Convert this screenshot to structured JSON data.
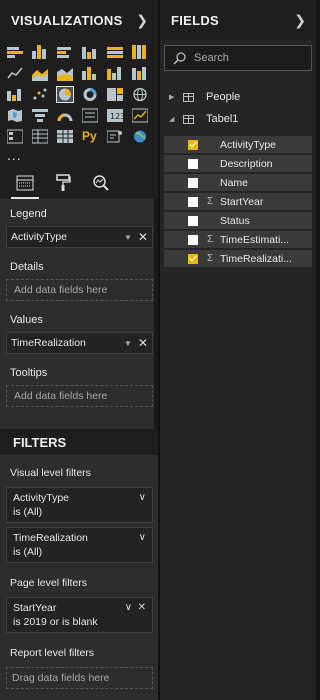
{
  "visualizations": {
    "title": "VISUALIZATIONS",
    "more": "..."
  },
  "tabs": [
    "fields-tab",
    "format-tab",
    "analytics-tab"
  ],
  "wells": {
    "legend_label": "Legend",
    "legend_field": "ActivityType",
    "details_label": "Details",
    "details_placeholder": "Add data fields here",
    "values_label": "Values",
    "values_field": "TimeRealization",
    "tooltips_label": "Tooltips",
    "tooltips_placeholder": "Add data fields here"
  },
  "filters": {
    "title": "FILTERS",
    "visual_level": "Visual level filters",
    "visual_items": [
      {
        "name": "ActivityType",
        "state": "is (All)"
      },
      {
        "name": "TimeRealization",
        "state": "is (All)"
      }
    ],
    "page_level": "Page level filters",
    "page_items": [
      {
        "name": "StartYear",
        "state": "is 2019 or is blank"
      }
    ],
    "report_level": "Report level filters",
    "report_placeholder": "Drag data fields here"
  },
  "fields": {
    "title": "FIELDS",
    "search_placeholder": "Search",
    "tables": [
      "People",
      "Tabel1"
    ],
    "items": [
      {
        "name": "ActivityType",
        "checked": true,
        "sigma": false
      },
      {
        "name": "Description",
        "checked": false,
        "sigma": false
      },
      {
        "name": "Name",
        "checked": false,
        "sigma": false
      },
      {
        "name": "StartYear",
        "checked": false,
        "sigma": true
      },
      {
        "name": "Status",
        "checked": false,
        "sigma": false
      },
      {
        "name": "TimeEstimati...",
        "checked": false,
        "sigma": true
      },
      {
        "name": "TimeRealizati...",
        "checked": true,
        "sigma": true
      }
    ]
  },
  "colors": {
    "accent_check": "#e9b61a",
    "pane_bg": "#2d2d2d",
    "header_bg": "#1e1e1e"
  }
}
